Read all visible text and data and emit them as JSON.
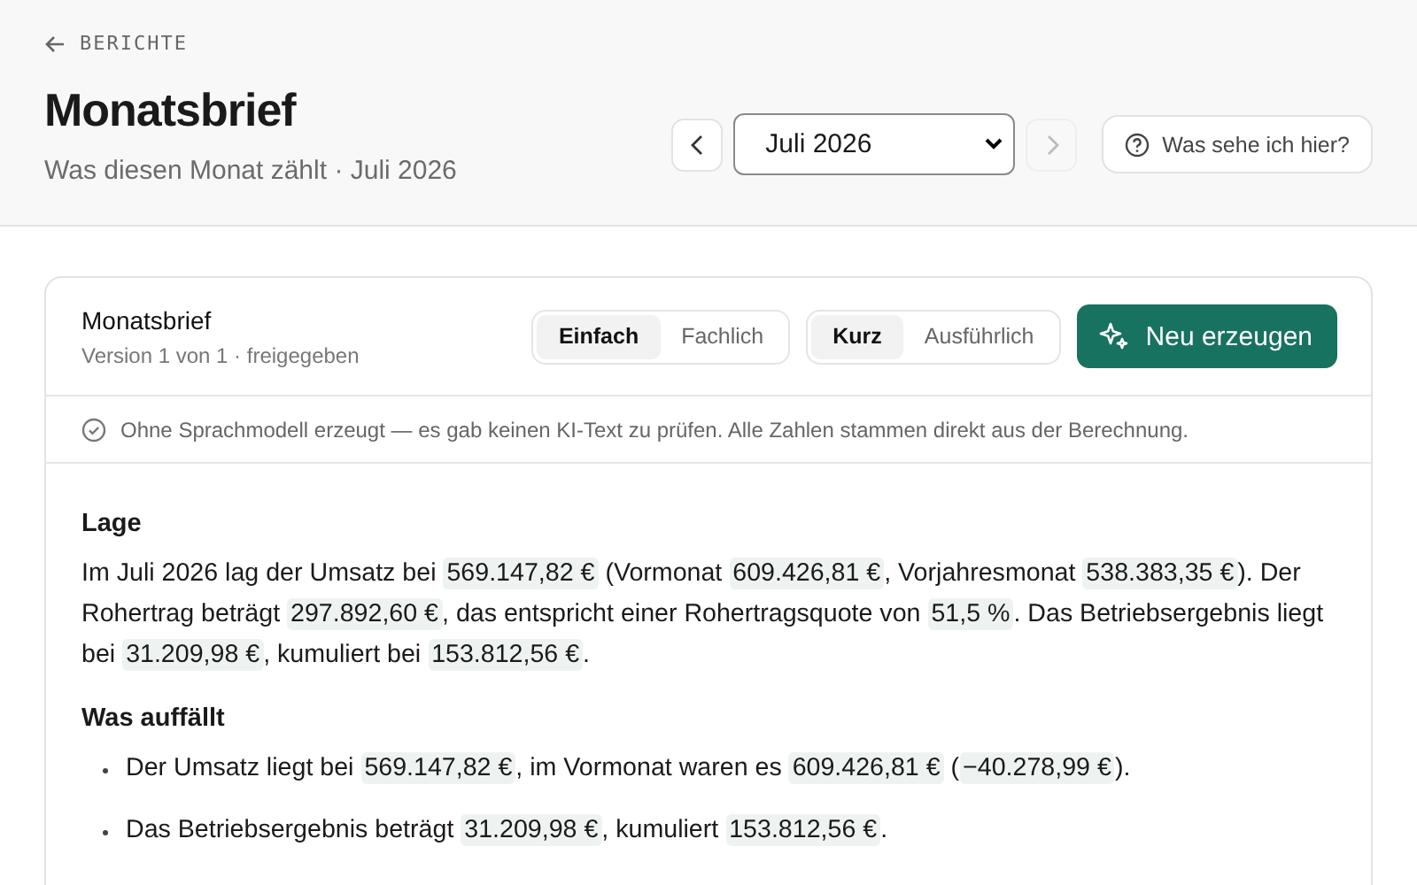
{
  "breadcrumb": {
    "label": "BERICHTE"
  },
  "header": {
    "title": "Monatsbrief",
    "subtitle": "Was diesen Monat zählt · Juli 2026"
  },
  "period": {
    "prev_disabled": false,
    "value": "Juli 2026",
    "next_disabled": true
  },
  "help_button": {
    "label": "Was sehe ich hier?"
  },
  "card": {
    "title": "Monatsbrief",
    "meta": "Version 1 von 1 · freigegeben",
    "style_toggle": [
      {
        "label": "Einfach",
        "selected": true
      },
      {
        "label": "Fachlich",
        "selected": false
      }
    ],
    "length_toggle": [
      {
        "label": "Kurz",
        "selected": true
      },
      {
        "label": "Ausführlich",
        "selected": false
      }
    ],
    "generate_button": {
      "label": "Neu erzeugen"
    },
    "notice": "Ohne Sprachmodell erzeugt — es gab keinen KI-Text zu prüfen. Alle Zahlen stammen direkt aus der Berechnung.",
    "sections": [
      {
        "heading": "Lage",
        "kind": "paragraph",
        "paragraphs": [
          [
            {
              "kind": "plain",
              "text": "Im Juli 2026 lag der Umsatz bei "
            },
            {
              "kind": "value",
              "text": "569.147,82 €"
            },
            {
              "kind": "plain",
              "text": " (Vormonat "
            },
            {
              "kind": "value",
              "text": "609.426,81 €"
            },
            {
              "kind": "plain",
              "text": ", Vorjahresmonat "
            },
            {
              "kind": "value",
              "text": "538.383,35 €"
            },
            {
              "kind": "plain",
              "text": "). Der Rohertrag beträgt "
            },
            {
              "kind": "value",
              "text": "297.892,60 €"
            },
            {
              "kind": "plain",
              "text": ", das entspricht einer Rohertragsquote von "
            },
            {
              "kind": "value",
              "text": "51,5 %"
            },
            {
              "kind": "plain",
              "text": ". Das Betriebsergebnis liegt bei "
            },
            {
              "kind": "value",
              "text": "31.209,98 €"
            },
            {
              "kind": "plain",
              "text": ", kumuliert bei "
            },
            {
              "kind": "value",
              "text": "153.812,56 €"
            },
            {
              "kind": "plain",
              "text": "."
            }
          ]
        ]
      },
      {
        "heading": "Was auffällt",
        "kind": "list",
        "paragraphs": [
          [
            {
              "kind": "plain",
              "text": "Der Umsatz liegt bei "
            },
            {
              "kind": "value",
              "text": "569.147,82 €"
            },
            {
              "kind": "plain",
              "text": ", im Vormonat waren es "
            },
            {
              "kind": "value",
              "text": "609.426,81 €"
            },
            {
              "kind": "plain",
              "text": " ("
            },
            {
              "kind": "value",
              "text": "−40.278,99 €"
            },
            {
              "kind": "plain",
              "text": ")."
            }
          ],
          [
            {
              "kind": "plain",
              "text": "Das Betriebsergebnis beträgt "
            },
            {
              "kind": "value",
              "text": "31.209,98 €"
            },
            {
              "kind": "plain",
              "text": ", kumuliert "
            },
            {
              "kind": "value",
              "text": "153.812,56 €"
            },
            {
              "kind": "plain",
              "text": "."
            }
          ]
        ]
      }
    ]
  }
}
